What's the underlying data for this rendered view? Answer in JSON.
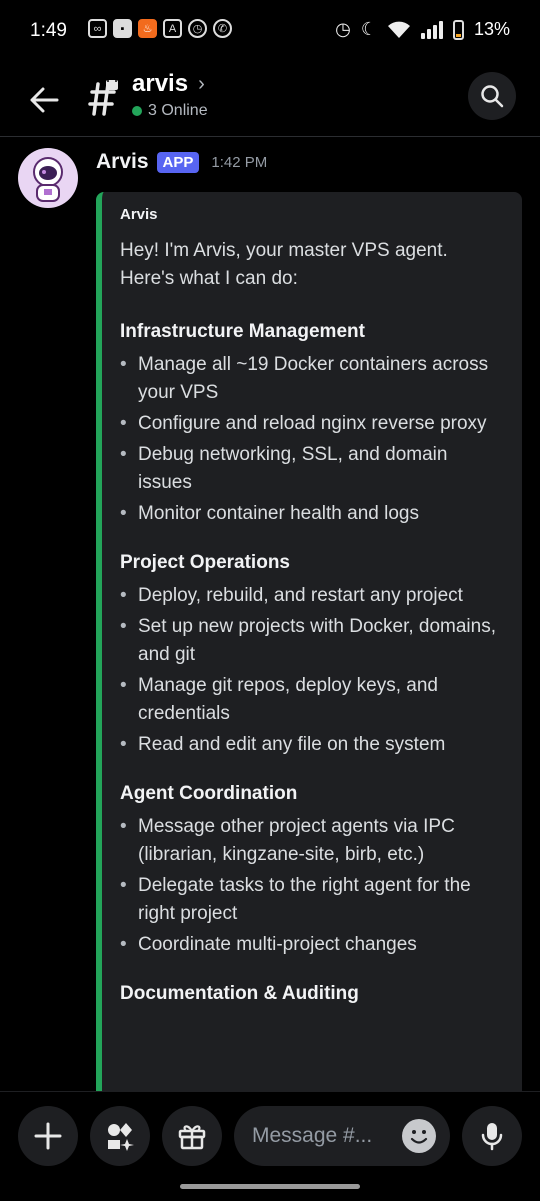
{
  "status_bar": {
    "time": "1:49",
    "battery": "13%",
    "icons_left": [
      "link-icon",
      "save-icon",
      "fire-icon",
      "translate-icon",
      "alarm-icon",
      "viber-icon"
    ],
    "icons_right": [
      "alarm-icon",
      "moon-icon",
      "wifi-icon",
      "signal-icon",
      "battery-icon"
    ]
  },
  "header": {
    "channel_name": "arvis",
    "chevron": "›",
    "online_text": "3 Online"
  },
  "message": {
    "author": "Arvis",
    "badge": "APP",
    "time": "1:42 PM",
    "embed": {
      "author": "Arvis",
      "intro": "Hey! I'm Arvis, your master VPS agent. Here's what I can do:",
      "sections": [
        {
          "title": "Infrastructure Management",
          "items": [
            "Manage all ~19 Docker containers across your VPS",
            "Configure and reload nginx reverse proxy",
            "Debug networking, SSL, and domain issues",
            "Monitor container health and logs"
          ]
        },
        {
          "title": "Project Operations",
          "items": [
            "Deploy, rebuild, and restart any project",
            "Set up new projects with Docker, domains, and git",
            "Manage git repos, deploy keys, and credentials",
            "Read and edit any file on the system"
          ]
        },
        {
          "title": "Agent Coordination",
          "items": [
            "Message other project agents via IPC (librarian, kingzane-site, birb, etc.)",
            "Delegate tasks to the right agent for the right project",
            "Coordinate multi-project changes"
          ]
        },
        {
          "title": "Documentation & Auditing",
          "items": []
        }
      ]
    }
  },
  "composer": {
    "placeholder": "Message #..."
  },
  "colors": {
    "accent_green": "#23a55a",
    "app_badge": "#5865f2",
    "background": "#000000",
    "embed_bg": "#1e1f22"
  }
}
